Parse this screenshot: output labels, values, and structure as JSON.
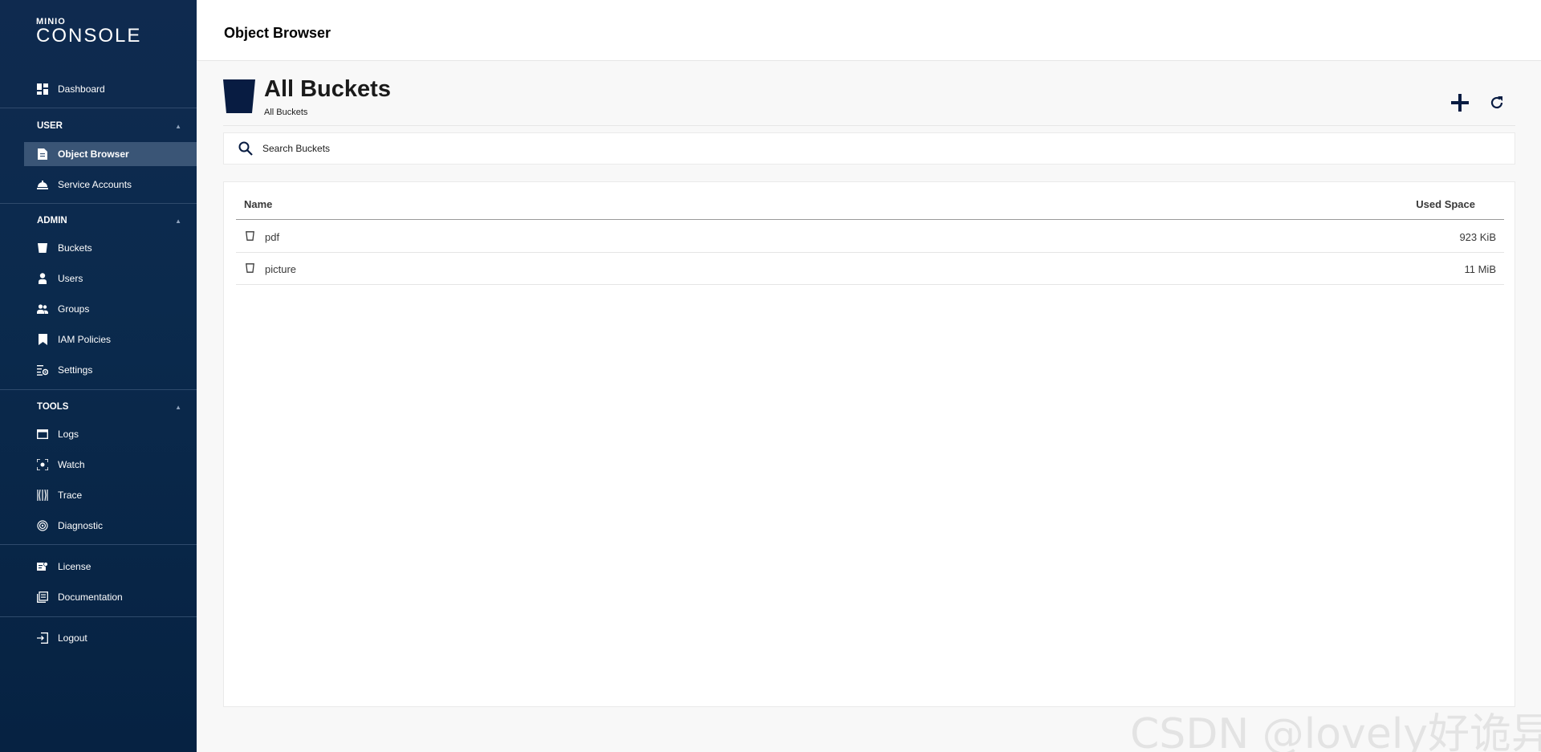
{
  "app": {
    "logo_small": "MINIO",
    "logo_big": "CONSOLE"
  },
  "sidebar": {
    "dashboard": "Dashboard",
    "user_section": "USER",
    "object_browser": "Object Browser",
    "service_accounts": "Service Accounts",
    "admin_section": "ADMIN",
    "buckets": "Buckets",
    "users": "Users",
    "groups": "Groups",
    "iam_policies": "IAM Policies",
    "settings": "Settings",
    "tools_section": "TOOLS",
    "logs": "Logs",
    "watch": "Watch",
    "trace": "Trace",
    "diagnostic": "Diagnostic",
    "license": "License",
    "documentation": "Documentation",
    "logout": "Logout"
  },
  "header": {
    "title": "Object Browser"
  },
  "page": {
    "title": "All Buckets",
    "subtitle": "All Buckets"
  },
  "search": {
    "placeholder": "Search Buckets"
  },
  "table": {
    "col_name": "Name",
    "col_space": "Used Space",
    "rows": [
      {
        "name": "pdf",
        "size": "923 KiB"
      },
      {
        "name": "picture",
        "size": "11 MiB"
      }
    ]
  },
  "watermark": "CSDN @lovely好诡异",
  "colors": {
    "sidebar_bg": "#0b2a4d",
    "active_item": "#3a5576",
    "accent_dark": "#081c42"
  }
}
